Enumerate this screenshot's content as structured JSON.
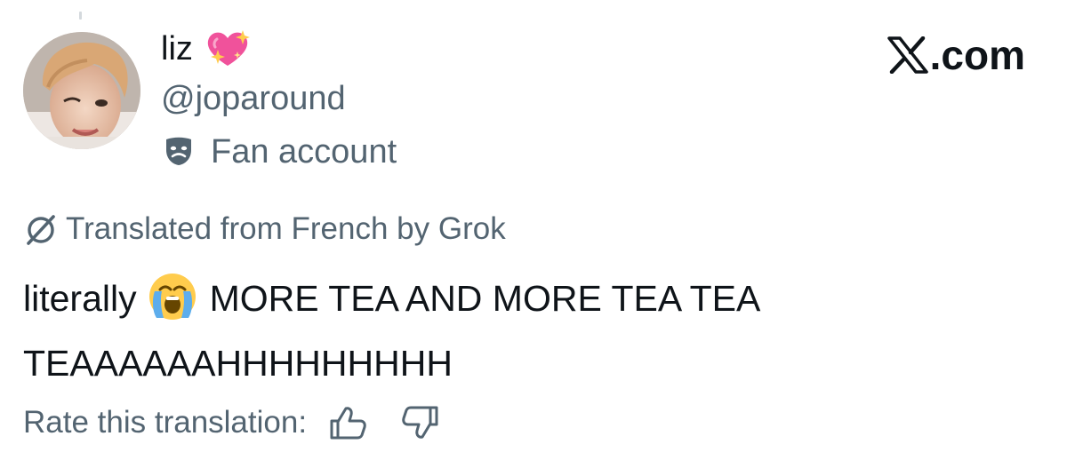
{
  "author": {
    "display_name": "liz",
    "name_emoji": "sparkling-heart",
    "handle": "@joparound",
    "account_label": "Fan account",
    "account_label_icon": "theater-masks-icon"
  },
  "brand": {
    "text": ".com"
  },
  "translation": {
    "notice": "Translated from French by Grok",
    "icon": "grok-icon"
  },
  "tweet": {
    "text_before_emoji": "literally",
    "emoji": "loudly-crying-face",
    "text_after_emoji": "MORE TEA AND MORE TEA TEA",
    "text_line2": "TEAAAAAAHHHHHHHHH"
  },
  "rating": {
    "label": "Rate this translation:",
    "up_icon": "thumbs-up-icon",
    "down_icon": "thumbs-down-icon"
  },
  "colors": {
    "primary_text": "#0f1419",
    "secondary_text": "#536471",
    "background": "#ffffff",
    "emoji_pink": "#f0529b",
    "emoji_yellow": "#ffcc4d"
  }
}
